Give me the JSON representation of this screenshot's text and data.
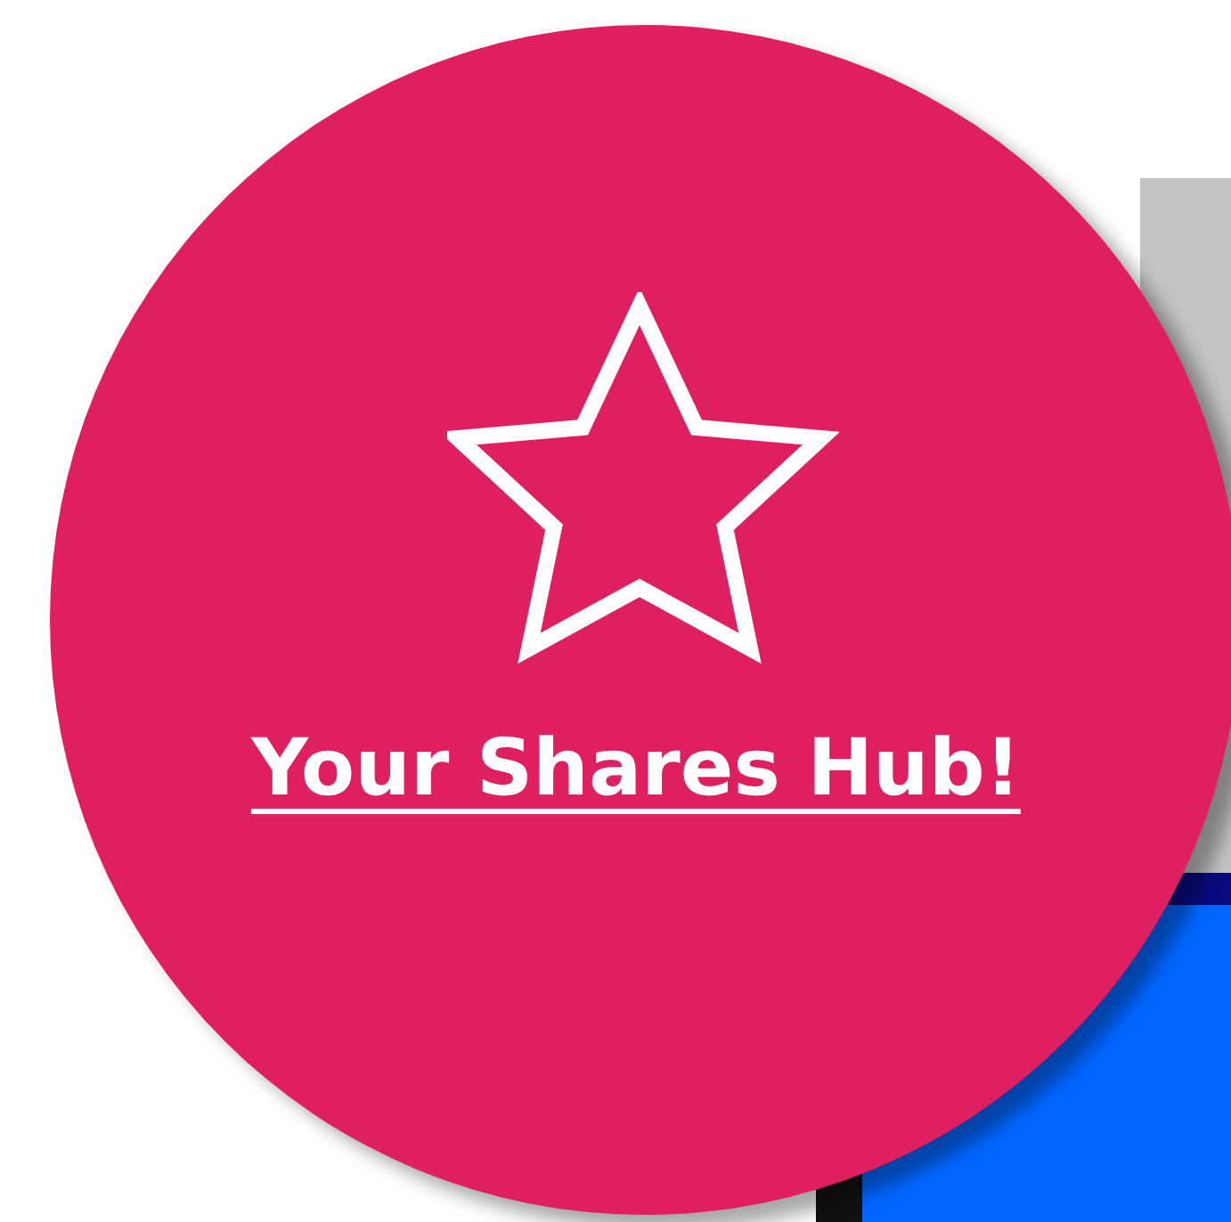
{
  "promo": {
    "link": "Your Shares Hub!"
  }
}
